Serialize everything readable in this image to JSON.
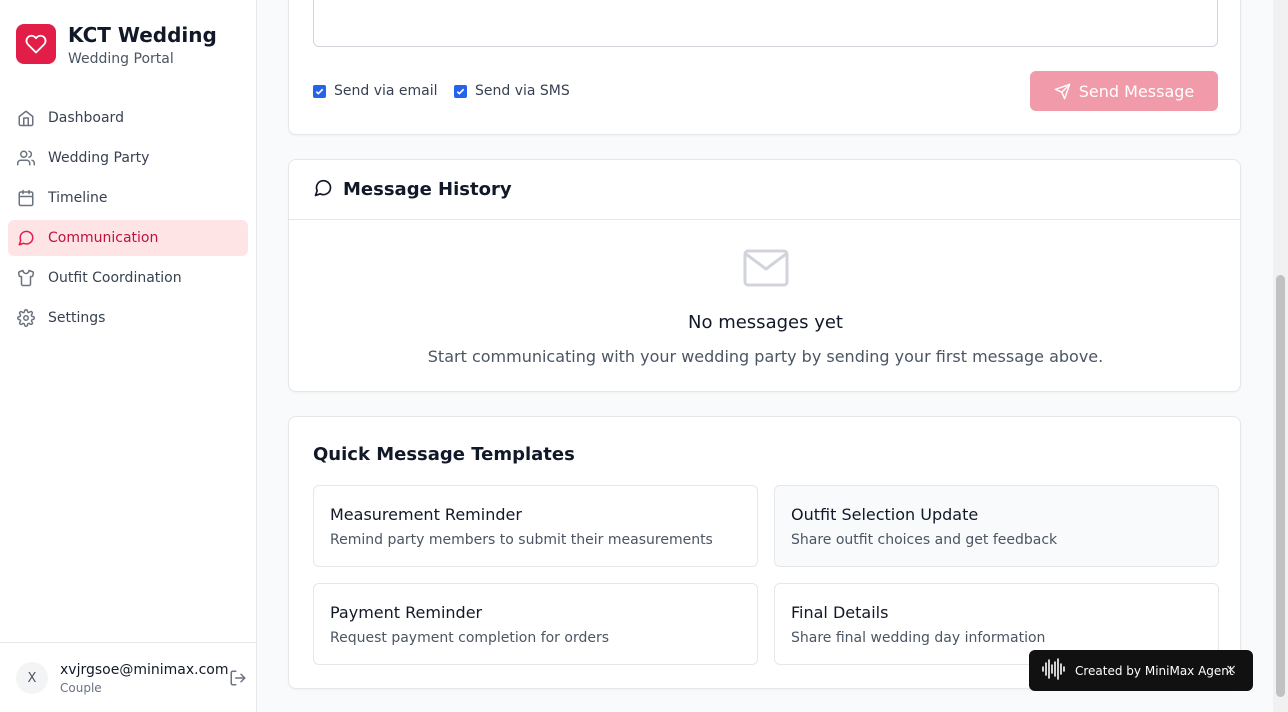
{
  "brand": {
    "title": "KCT Wedding",
    "subtitle": "Wedding Portal",
    "accent": "#e11d48"
  },
  "nav": [
    {
      "label": "Dashboard",
      "icon": "home-icon",
      "active": false
    },
    {
      "label": "Wedding Party",
      "icon": "users-icon",
      "active": false
    },
    {
      "label": "Timeline",
      "icon": "calendar-icon",
      "active": false
    },
    {
      "label": "Communication",
      "icon": "message-circle-icon",
      "active": true
    },
    {
      "label": "Outfit Coordination",
      "icon": "shirt-icon",
      "active": false
    },
    {
      "label": "Settings",
      "icon": "gear-icon",
      "active": false
    }
  ],
  "user": {
    "initial": "X",
    "email": "xvjrgsoe@minimax.com",
    "role": "Couple"
  },
  "compose": {
    "message_value": "",
    "send_email_label": "Send via email",
    "send_email_checked": true,
    "send_sms_label": "Send via SMS",
    "send_sms_checked": true,
    "send_button_label": "Send Message"
  },
  "history": {
    "title": "Message History",
    "empty_title": "No messages yet",
    "empty_text": "Start communicating with your wedding party by sending your first message above."
  },
  "templates": {
    "title": "Quick Message Templates",
    "items": [
      {
        "name": "Measurement Reminder",
        "description": "Remind party members to submit their measurements"
      },
      {
        "name": "Outfit Selection Update",
        "description": "Share outfit choices and get feedback"
      },
      {
        "name": "Payment Reminder",
        "description": "Request payment completion for orders"
      },
      {
        "name": "Final Details",
        "description": "Share final wedding day information"
      }
    ]
  },
  "badge": {
    "label": "Created by MiniMax Agent",
    "close": "×"
  }
}
